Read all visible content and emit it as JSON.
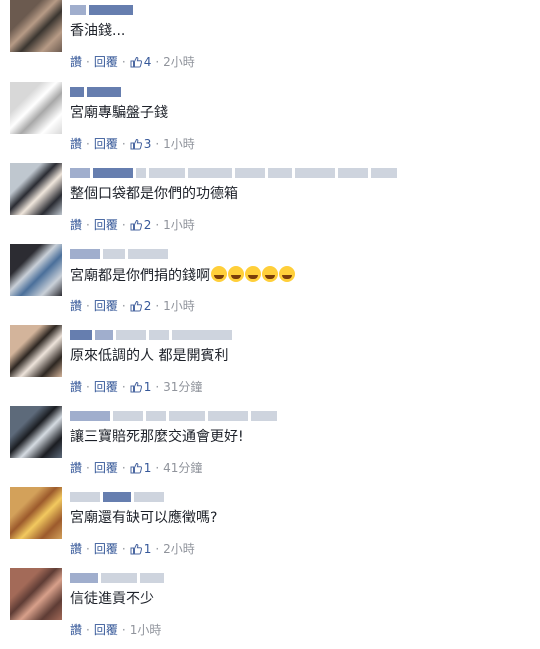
{
  "comments": [
    {
      "text": "香油錢...",
      "reply": "讚",
      "answer": "回覆",
      "likes": "4",
      "time": "2小時",
      "avatar_colors": [
        "#6b5a4f",
        "#b79b86",
        "#3a3530"
      ],
      "emoji_count": 0
    },
    {
      "text": "宮廟專騙盤子錢",
      "reply": "讚",
      "answer": "回覆",
      "likes": "3",
      "time": "1小時",
      "avatar_colors": [
        "#d8d8d8",
        "#ffffff",
        "#a8a8a8"
      ],
      "emoji_count": 0
    },
    {
      "text": "整個口袋都是你們的功德箱",
      "reply": "讚",
      "answer": "回覆",
      "likes": "2",
      "time": "1小時",
      "avatar_colors": [
        "#bfc7cf",
        "#2a2c33",
        "#f0e6dc"
      ],
      "emoji_count": 0
    },
    {
      "text": "宮廟都是你們捐的錢啊",
      "reply": "讚",
      "answer": "回覆",
      "likes": "2",
      "time": "1小時",
      "avatar_colors": [
        "#2c2c32",
        "#c9d0d8",
        "#4a6f9a"
      ],
      "emoji_count": 5
    },
    {
      "text": "原來低調的人 都是開賓利",
      "reply": "讚",
      "answer": "回覆",
      "likes": "1",
      "time": "31分鐘",
      "avatar_colors": [
        "#d3b49b",
        "#2e2722",
        "#ede3da"
      ],
      "emoji_count": 0
    },
    {
      "text": "讓三寶賠死那麼交通會更好!",
      "reply": "讚",
      "answer": "回覆",
      "likes": "1",
      "time": "41分鐘",
      "avatar_colors": [
        "#5d6a7a",
        "#1b1d22",
        "#d5dbe2"
      ],
      "emoji_count": 0
    },
    {
      "text": "宮廟還有缺可以應徵嗎?",
      "reply": "讚",
      "answer": "回覆",
      "likes": "1",
      "time": "2小時",
      "avatar_colors": [
        "#d3a15a",
        "#9c5a2c",
        "#f2c95f"
      ],
      "emoji_count": 0
    },
    {
      "text": "信徒進貢不少",
      "reply": "讚",
      "answer": "回覆",
      "likes": "",
      "time": "1小時",
      "avatar_colors": [
        "#a36a58",
        "#5e3c35",
        "#d8a08a"
      ],
      "emoji_count": 0
    }
  ],
  "colors": {
    "link": "#365899",
    "text": "#1d2129",
    "meta": "#90949c",
    "name": "#4b67a1"
  }
}
